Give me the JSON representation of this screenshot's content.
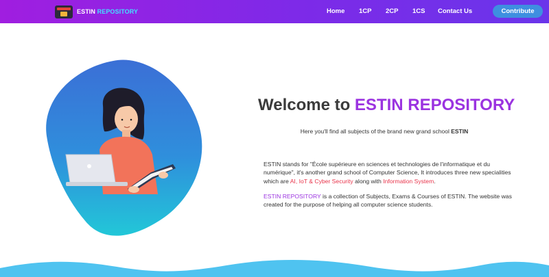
{
  "navbar": {
    "logo_brand": "ESTIN",
    "logo_brand_accent": "REPOSITORY",
    "links": [
      {
        "label": "Home"
      },
      {
        "label": "1CP"
      },
      {
        "label": "2CP"
      },
      {
        "label": "1CS"
      },
      {
        "label": "Contact Us"
      }
    ],
    "cta_label": "Contribute"
  },
  "hero": {
    "title_prefix": "Welcome to",
    "title_accent": "ESTIN REPOSITORY",
    "subtitle_text": "Here you'll find all subjects of the brand new grand school",
    "subtitle_bold": "ESTIN",
    "para1_part1": "ESTIN stands for \"École supérieure en sciences et technologies de l'informatique et du numérique\", it's another grand school of Computer Science, It introduces three new specialities which are",
    "para1_highlight1": "AI, IoT & Cyber Security",
    "para1_part2": "along with",
    "para1_highlight2": "Information System",
    "para1_end": ".",
    "para2_highlight": "ESTIN REPOSITORY",
    "para2_text": "is a collection of Subjects, Exams & Courses of ESTIN. The website was created for the purpose of helping all computer science students."
  },
  "colors": {
    "navbar_gradient_start": "#a01ee0",
    "navbar_gradient_end": "#6a35ea",
    "accent_purple": "#9b33e0",
    "highlight_red": "#e8334a",
    "button_blue": "#3e8fe0",
    "wave_blue": "#4fc3f0"
  },
  "icons": {
    "logo": "treasure-chest-icon",
    "illustration": "woman-reading-book-with-laptop"
  }
}
